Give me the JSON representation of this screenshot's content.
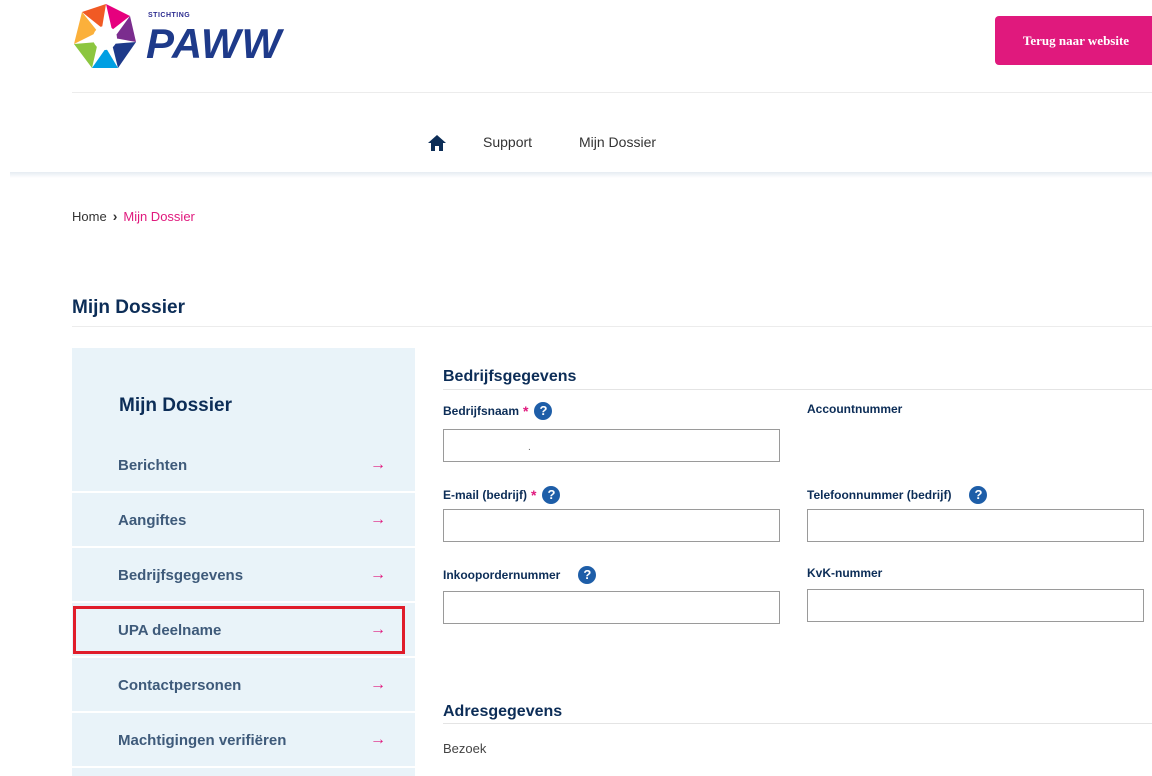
{
  "header": {
    "logo_small": "STICHTING",
    "logo_big": "PAWW",
    "back_button": "Terug naar website"
  },
  "nav": {
    "items": [
      "Support",
      "Mijn Dossier"
    ]
  },
  "breadcrumb": {
    "home": "Home",
    "current": "Mijn Dossier"
  },
  "page_title": "Mijn Dossier",
  "sidebar": {
    "title": "Mijn Dossier",
    "arrow": "→",
    "items": [
      {
        "label": "Berichten"
      },
      {
        "label": "Aangiftes"
      },
      {
        "label": "Bedrijfsgegevens"
      },
      {
        "label": "UPA deelname"
      },
      {
        "label": "Contactpersonen"
      },
      {
        "label": "Machtigingen verifiëren"
      }
    ]
  },
  "form": {
    "section_company": "Bedrijfsgegevens",
    "company_name_label": "Bedrijfsnaam",
    "company_name_value": ".",
    "account_number_label": "Accountnummer",
    "email_label": "E-mail (bedrijf)",
    "phone_label": "Telefoonnummer (bedrijf)",
    "purchase_order_label": "Inkoopordernummer",
    "kvk_label": "KvK-nummer",
    "required_mark": "*",
    "help_glyph": "?",
    "section_address": "Adresgegevens",
    "visit_label": "Bezoek"
  },
  "colors": {
    "brand_pink": "#e0197d",
    "navy": "#0c2d57",
    "sidebar_bg": "#e9f3f9",
    "highlight_red": "#e01c2a"
  }
}
